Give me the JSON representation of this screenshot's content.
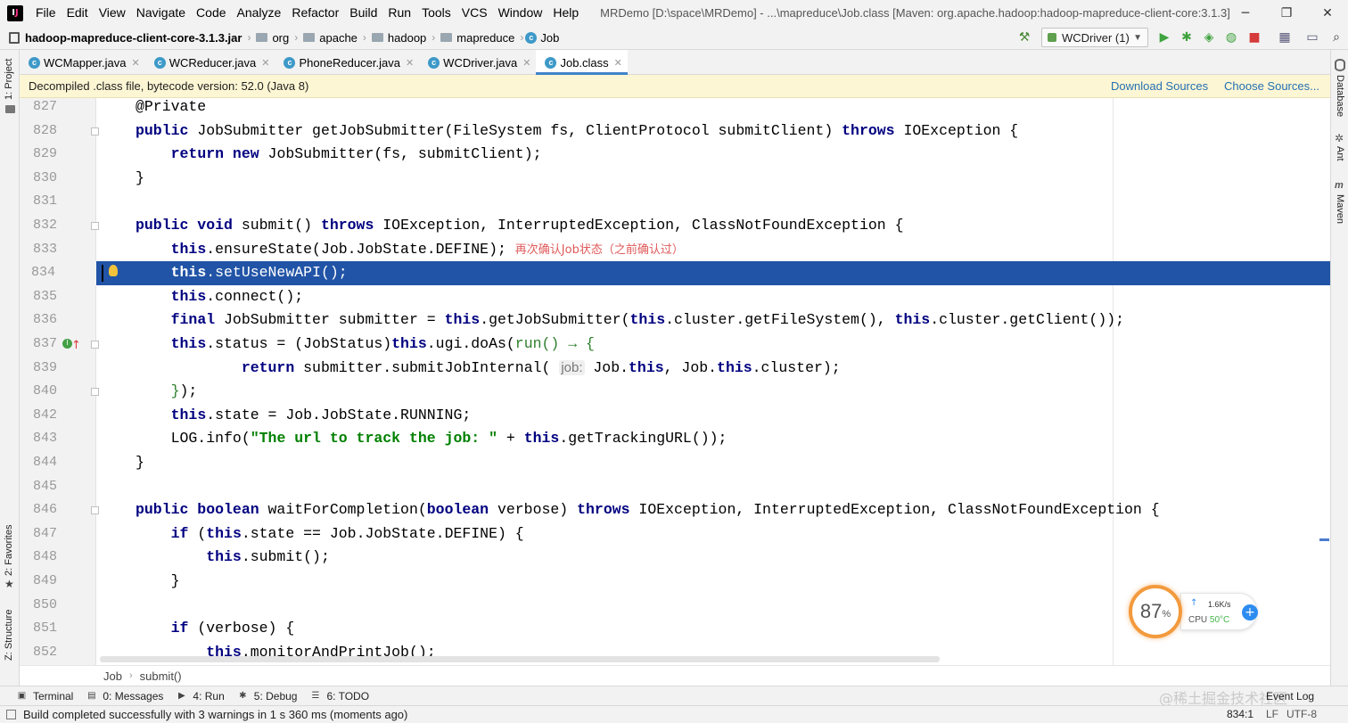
{
  "menubar": {
    "items": [
      "File",
      "Edit",
      "View",
      "Navigate",
      "Code",
      "Analyze",
      "Refactor",
      "Build",
      "Run",
      "Tools",
      "VCS",
      "Window",
      "Help"
    ],
    "title": "MRDemo [D:\\space\\MRDemo] - ...\\mapreduce\\Job.class [Maven: org.apache.hadoop:hadoop-mapreduce-client-core:3.1.3]"
  },
  "navbar": {
    "jar": "hadoop-mapreduce-client-core-3.1.3.jar",
    "crumbs": [
      "org",
      "apache",
      "hadoop",
      "mapreduce"
    ],
    "class": "Job",
    "run_config": "WCDriver (1)"
  },
  "tabs": [
    {
      "label": "WCMapper.java",
      "active": false
    },
    {
      "label": "WCReducer.java",
      "active": false
    },
    {
      "label": "PhoneReducer.java",
      "active": false
    },
    {
      "label": "WCDriver.java",
      "active": false
    },
    {
      "label": "Job.class",
      "active": true
    }
  ],
  "banner": {
    "text": "Decompiled .class file, bytecode version: 52.0 (Java 8)",
    "download": "Download Sources",
    "choose": "Choose Sources..."
  },
  "side_tabs": {
    "left": [
      "1: Project",
      "2: Favorites",
      "Z: Structure"
    ],
    "right": [
      "Database",
      "Ant",
      "Maven"
    ]
  },
  "code": {
    "selected_line": "834",
    "lines": [
      {
        "n": "827",
        "html": "<span class=\"ann\">@Private</span>"
      },
      {
        "n": "828",
        "html": "<span class=\"kw\">public</span> JobSubmitter getJobSubmitter(FileSystem fs, ClientProtocol submitClient) <span class=\"kw\">throws</span> IOException {"
      },
      {
        "n": "829",
        "html": "    <span class=\"kw\">return new</span> JobSubmitter(fs, submitClient);"
      },
      {
        "n": "830",
        "html": "}"
      },
      {
        "n": "831",
        "html": ""
      },
      {
        "n": "832",
        "html": "<span class=\"kw\">public void</span> submit() <span class=\"kw\">throws</span> IOException, InterruptedException, ClassNotFoundException {"
      },
      {
        "n": "833",
        "html": "    <span class=\"kw\">this</span>.ensureState(Job.JobState.DEFINE); <span class=\"comment-cn\">再次确认Job状态（之前确认过）</span>"
      },
      {
        "n": "834",
        "html": "    <span class=\"kw\">this</span>.setUseNewAPI();"
      },
      {
        "n": "835",
        "html": "    <span class=\"kw\">this</span>.connect();"
      },
      {
        "n": "836",
        "html": "    <span class=\"kw\">final</span> JobSubmitter submitter = <span class=\"kw\">this</span>.getJobSubmitter(<span class=\"kw\">this</span>.cluster.getFileSystem(), <span class=\"kw\">this</span>.cluster.getClient());"
      },
      {
        "n": "837",
        "html": "    <span class=\"kw\">this</span>.status = (JobStatus)<span class=\"kw\">this</span>.ugi.doAs(<span class=\"lambda\">run() → {</span>"
      },
      {
        "n": "839",
        "html": "            <span class=\"kw\">return</span> submitter.submitJobInternal( <span class=\"hint\">job:</span> Job.<span class=\"kw\">this</span>, Job.<span class=\"kw\">this</span>.cluster);"
      },
      {
        "n": "840",
        "html": "    <span class=\"lambda\">}</span>);"
      },
      {
        "n": "842",
        "html": "    <span class=\"kw\">this</span>.state = Job.JobState.RUNNING;"
      },
      {
        "n": "843",
        "html": "    LOG.info(<span class=\"str\">\"The url to track the job: \"</span> + <span class=\"kw\">this</span>.getTrackingURL());"
      },
      {
        "n": "844",
        "html": "}"
      },
      {
        "n": "845",
        "html": ""
      },
      {
        "n": "846",
        "html": "<span class=\"kw\">public boolean</span> waitForCompletion(<span class=\"kw\">boolean</span> verbose) <span class=\"kw\">throws</span> IOException, InterruptedException, ClassNotFoundException {"
      },
      {
        "n": "847",
        "html": "    <span class=\"kw\">if</span> (<span class=\"kw\">this</span>.state == Job.JobState.DEFINE) {"
      },
      {
        "n": "848",
        "html": "        <span class=\"kw\">this</span>.submit();"
      },
      {
        "n": "849",
        "html": "    }"
      },
      {
        "n": "850",
        "html": ""
      },
      {
        "n": "851",
        "html": "    <span class=\"kw\">if</span> (verbose) {"
      },
      {
        "n": "852",
        "html": "        <span class=\"kw\">this</span>.monitorAndPrintJob();"
      }
    ]
  },
  "code_crumb": [
    "Job",
    "submit()"
  ],
  "cpu_widget": {
    "percent": "87",
    "percent_sign": "%",
    "speed": "1.6K/s",
    "cpu_label": "CPU",
    "temp": "50°C"
  },
  "tool_windows": [
    {
      "label": "Terminal",
      "icon": "terminal-icon",
      "glyph": "▣"
    },
    {
      "label": "0: Messages",
      "icon": "messages-icon",
      "glyph": "▤"
    },
    {
      "label": "4: Run",
      "icon": "run-icon",
      "glyph": "▶"
    },
    {
      "label": "5: Debug",
      "icon": "debug-icon",
      "glyph": "✱"
    },
    {
      "label": "6: TODO",
      "icon": "todo-icon",
      "glyph": "☰"
    }
  ],
  "event_log": "Event Log",
  "watermark": "@稀土掘金技术社区",
  "status": {
    "message": "Build completed successfully with 3 warnings in 1 s 360 ms (moments ago)",
    "position": "834:1",
    "line_sep": "LF",
    "encoding": "UTF-8"
  }
}
